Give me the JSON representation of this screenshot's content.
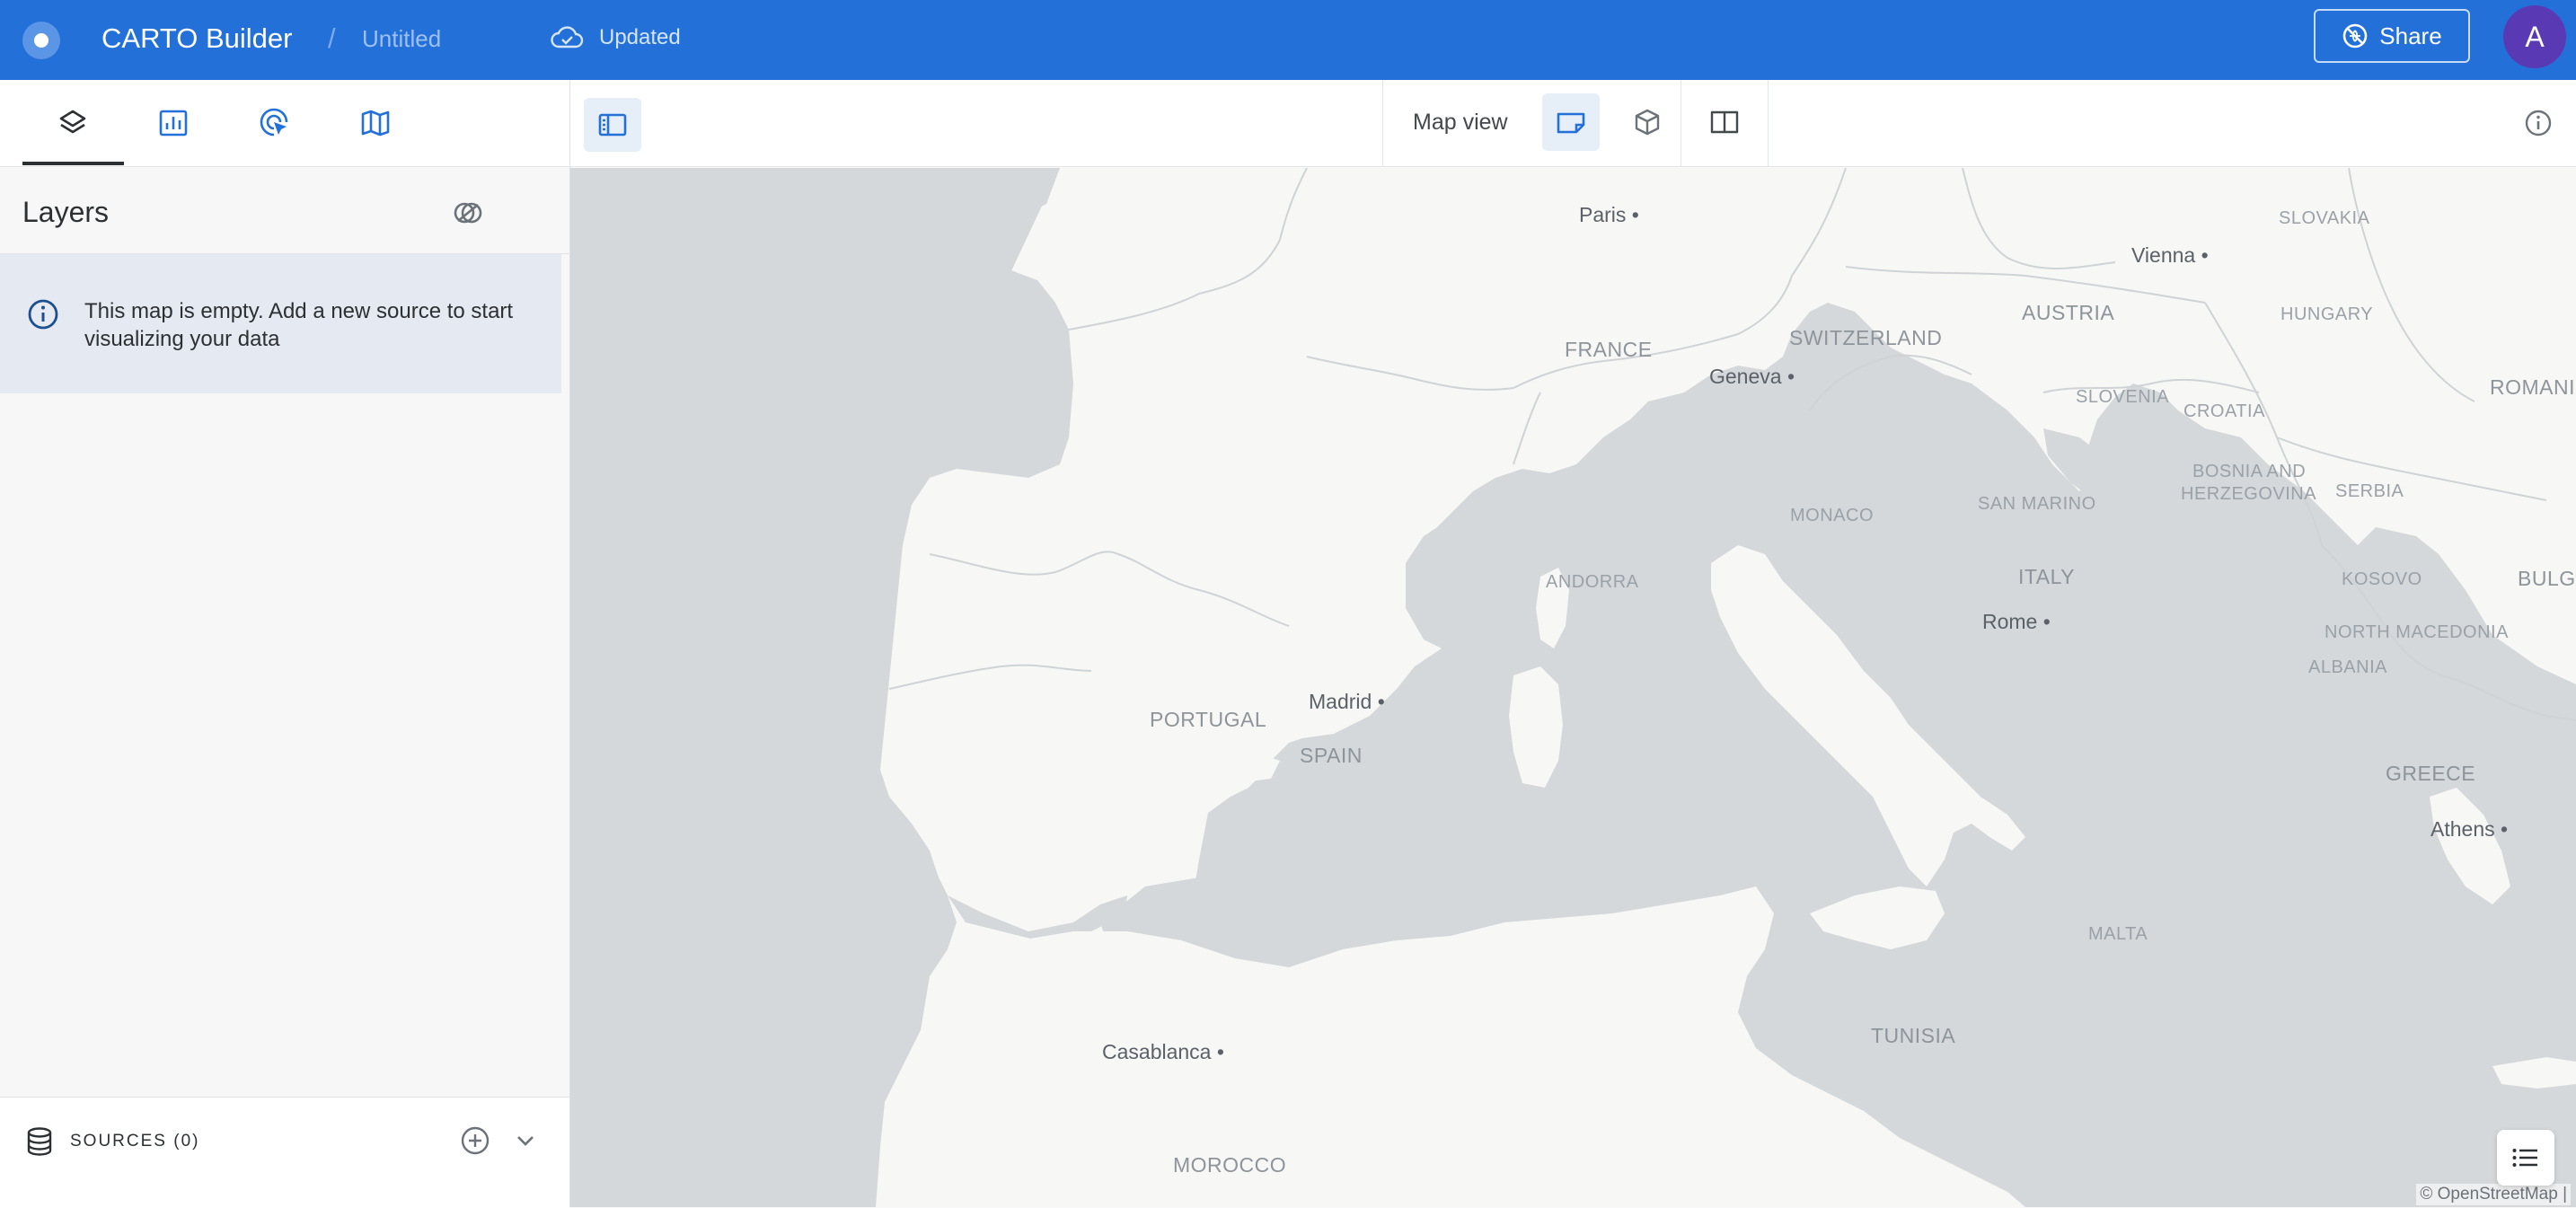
{
  "header": {
    "app_title": "CARTO Builder",
    "separator": "/",
    "map_name": "Untitled",
    "status": "Updated",
    "share_label": "Share",
    "avatar_initial": "A",
    "brand_color": "#2370d9"
  },
  "toolbar": {
    "tabs": [
      {
        "icon": "layers-icon",
        "active": true
      },
      {
        "icon": "widgets-icon",
        "active": false
      },
      {
        "icon": "interactions-icon",
        "active": false
      },
      {
        "icon": "basemap-icon",
        "active": false
      }
    ],
    "map_view_label": "Map view"
  },
  "sidebar": {
    "title": "Layers",
    "empty_message": "This map is empty. Add a new source to start visualizing your data",
    "sources_label": "SOURCES (0)"
  },
  "map": {
    "countries": [
      "SLOVAKIA",
      "AUSTRIA",
      "HUNGARY",
      "FRANCE",
      "SWITZERLAND",
      "SLOVENIA",
      "CROATIA",
      "ROMANI",
      "BOSNIA AND",
      "HERZEGOVINA",
      "SERBIA",
      "SAN MARINO",
      "MONACO",
      "ITALY",
      "KOSOVO",
      "BULG",
      "ANDORRA",
      "NORTH MACEDONIA",
      "ALBANIA",
      "PORTUGAL",
      "SPAIN",
      "GREECE",
      "MALTA",
      "TUNISIA",
      "MOROCCO"
    ],
    "cities": [
      "Paris",
      "Vienna",
      "Geneva",
      "Rome",
      "Madrid",
      "Athens",
      "Casablanca"
    ],
    "attribution": "© OpenStreetMap |"
  }
}
